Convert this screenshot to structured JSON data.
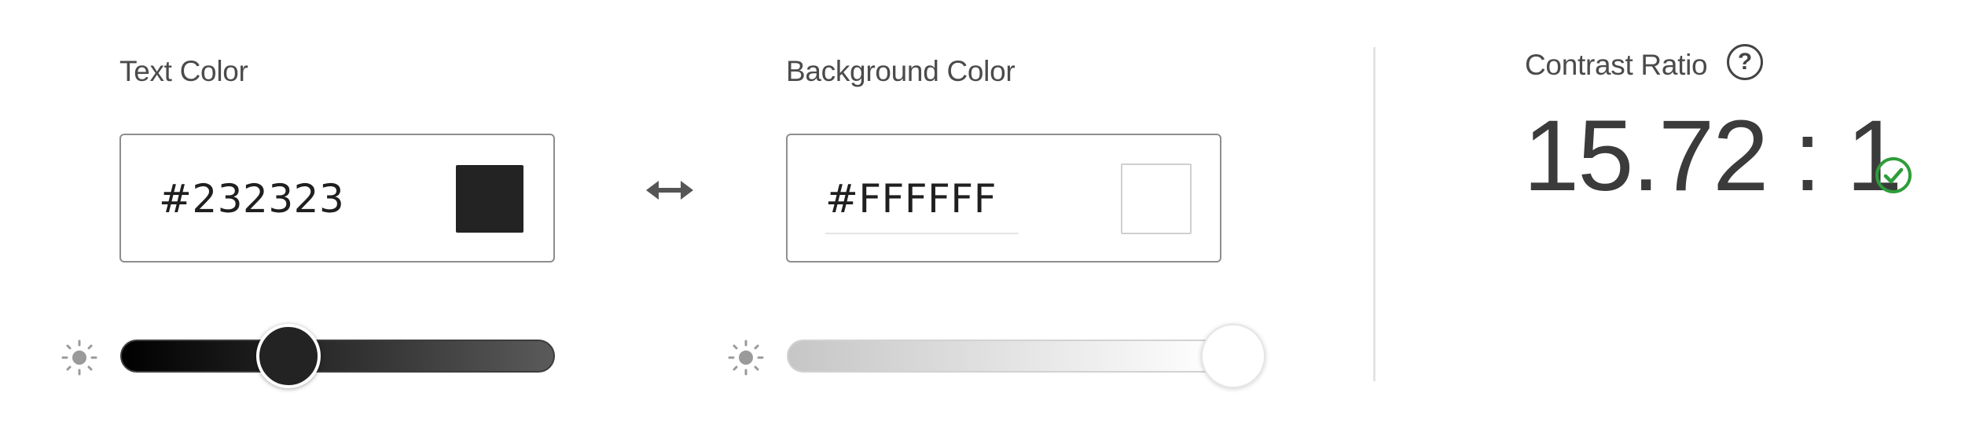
{
  "text_color": {
    "label": "Text Color",
    "hex_value": "#232323",
    "swatch_color": "#232323",
    "brightness": 0.39
  },
  "background_color": {
    "label": "Background Color",
    "hex_value": "#FFFFFF",
    "swatch_color": "#FFFFFF",
    "brightness": 1.0
  },
  "swap_icon": "double-arrow-icon",
  "contrast": {
    "label": "Contrast Ratio",
    "help_glyph": "?",
    "value": "15.72 : 1",
    "status_icon": "check-circle-icon",
    "status_color": "#2d9d3a"
  }
}
